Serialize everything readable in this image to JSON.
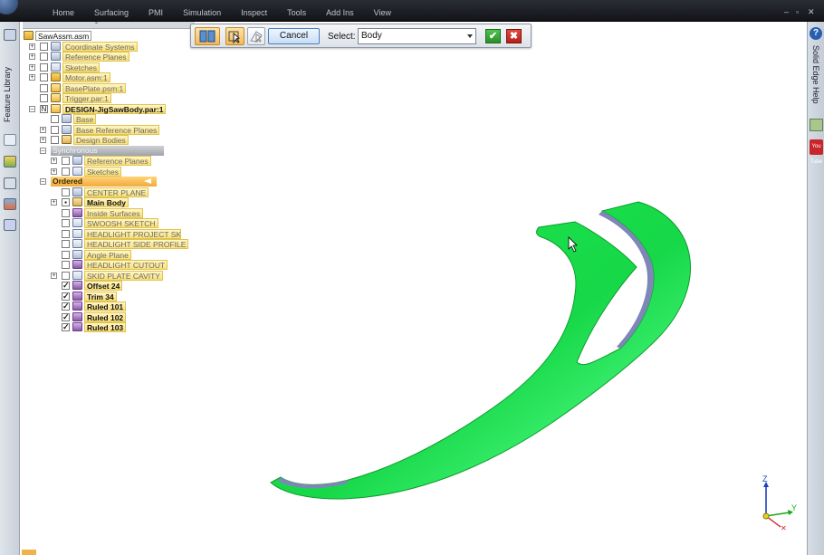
{
  "ribbon": {
    "tabs": [
      "Home",
      "Surfacing",
      "PMI",
      "Simulation",
      "Inspect",
      "Tools",
      "Add Ins",
      "View"
    ]
  },
  "left_strip": {
    "label": "Feature Library"
  },
  "right_strip": {
    "label": "Solid Edge Help",
    "youtube_label": "You Tube"
  },
  "command_bar": {
    "cancel_label": "Cancel",
    "select_label": "Select:",
    "select_value": "Body"
  },
  "tree": {
    "rows": [
      {
        "label": "SawAssm.asm"
      },
      {
        "label": "Coordinate Systems"
      },
      {
        "label": "Reference Planes"
      },
      {
        "label": "Sketches"
      },
      {
        "label": "Motor.asm:1"
      },
      {
        "label": "BasePlate.psm:1"
      },
      {
        "label": "Trigger.par:1"
      },
      {
        "label": "DESIGN-JigSawBody.par:1"
      },
      {
        "label": "Base"
      },
      {
        "label": "Base Reference Planes"
      },
      {
        "label": "Design Bodies"
      },
      {
        "label": "Synchronous"
      },
      {
        "label": "Reference Planes"
      },
      {
        "label": "Sketches"
      },
      {
        "label": "Ordered"
      },
      {
        "label": "CENTER PLANE"
      },
      {
        "label": "Main Body"
      },
      {
        "label": "Inside Surfaces"
      },
      {
        "label": "SWOOSH SKETCH"
      },
      {
        "label": "HEADLIGHT PROJECT SKETCH"
      },
      {
        "label": "HEADLIGHT SIDE PROFILE"
      },
      {
        "label": "Angle Plane"
      },
      {
        "label": "HEADLIGHT CUTOUT"
      },
      {
        "label": "SKID PLATE CAVITY"
      },
      {
        "label": "Offset 24"
      },
      {
        "label": "Trim 34"
      },
      {
        "label": "Ruled 101"
      },
      {
        "label": "Ruled 102"
      },
      {
        "label": "Ruled 103"
      }
    ]
  },
  "triad": {
    "z": "Z",
    "y": "Y"
  },
  "colors": {
    "model_green": "#17e04a",
    "model_edge": "#0c9c2c",
    "inner_face": "#7f86b8",
    "ok": "#2a8f2a",
    "cancel_x": "#b51f17"
  }
}
